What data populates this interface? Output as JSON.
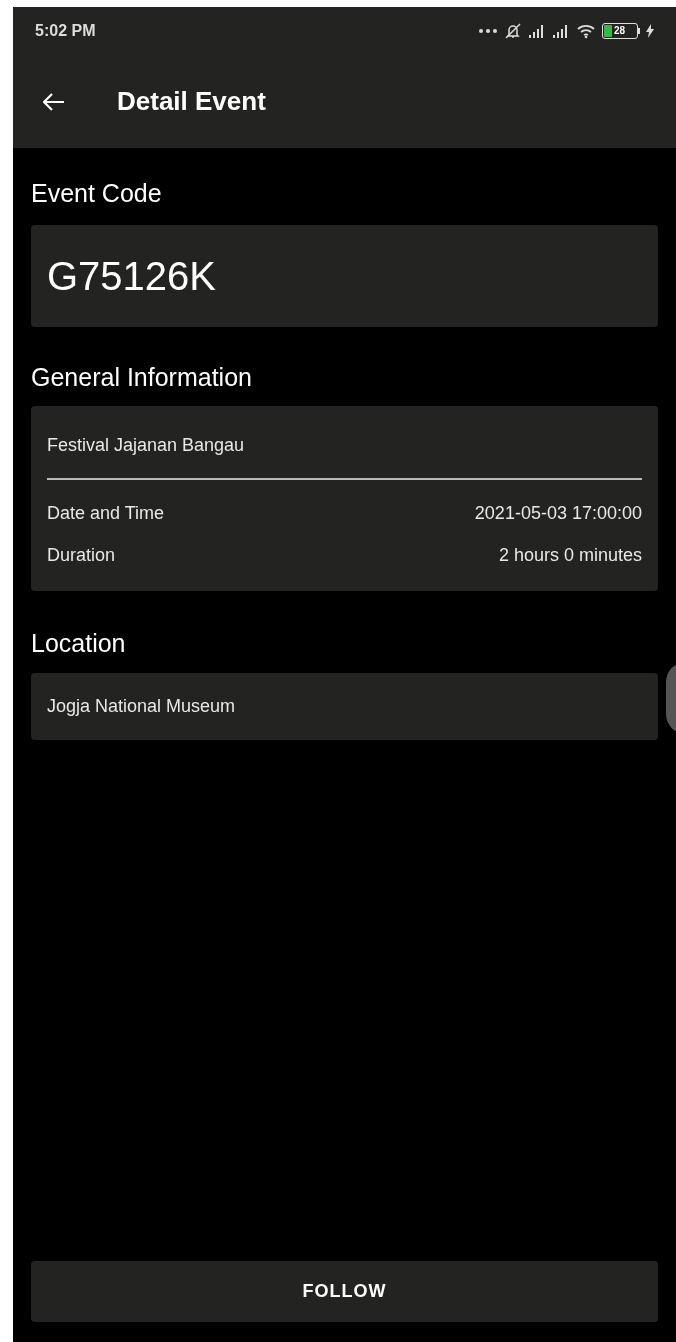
{
  "status_bar": {
    "time": "5:02 PM",
    "battery": "28"
  },
  "app_bar": {
    "title": "Detail Event"
  },
  "event_code": {
    "heading": "Event Code",
    "value": "G75126K"
  },
  "general_information": {
    "heading": "General Information",
    "name": "Festival Jajanan Bangau",
    "rows": [
      {
        "label": "Date and Time",
        "value": "2021-05-03 17:00:00"
      },
      {
        "label": "Duration",
        "value": "2 hours 0 minutes"
      }
    ]
  },
  "location": {
    "heading": "Location",
    "value": "Jogja National Museum"
  },
  "buttons": [
    "FOLLOW"
  ]
}
